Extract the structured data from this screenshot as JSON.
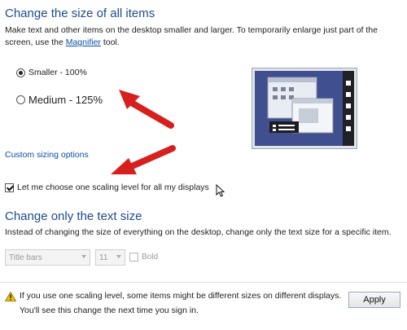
{
  "section1": {
    "title": "Change the size of all items",
    "desc_before_link": "Make text and other items on the desktop smaller and larger. To temporarily enlarge just part of the screen, use the ",
    "link": "Magnifier",
    "desc_after_link": " tool.",
    "options": [
      {
        "label": "Smaller - 100%",
        "selected": true
      },
      {
        "label": "Medium - 125%",
        "selected": false
      }
    ],
    "custom_link": "Custom sizing options",
    "checkbox": {
      "label": "Let me choose one scaling level for all my displays",
      "checked": true
    }
  },
  "section2": {
    "title": "Change only the text size",
    "desc": "Instead of changing the size of everything on the desktop, change only the text size for a specific item.",
    "item_select": "Title bars",
    "size_select": "11",
    "bold_label": "Bold",
    "bold_checked": false
  },
  "footer": {
    "warning_line1": "If you use one scaling level, some items might be different sizes on different displays.",
    "warning_line2": "You'll see this change the next time you sign in.",
    "apply_label": "Apply"
  },
  "colors": {
    "heading": "#1e4b8f",
    "link": "#0a4fa8",
    "arrow": "#d81f1f",
    "preview_bg": "#3f4f8f"
  }
}
